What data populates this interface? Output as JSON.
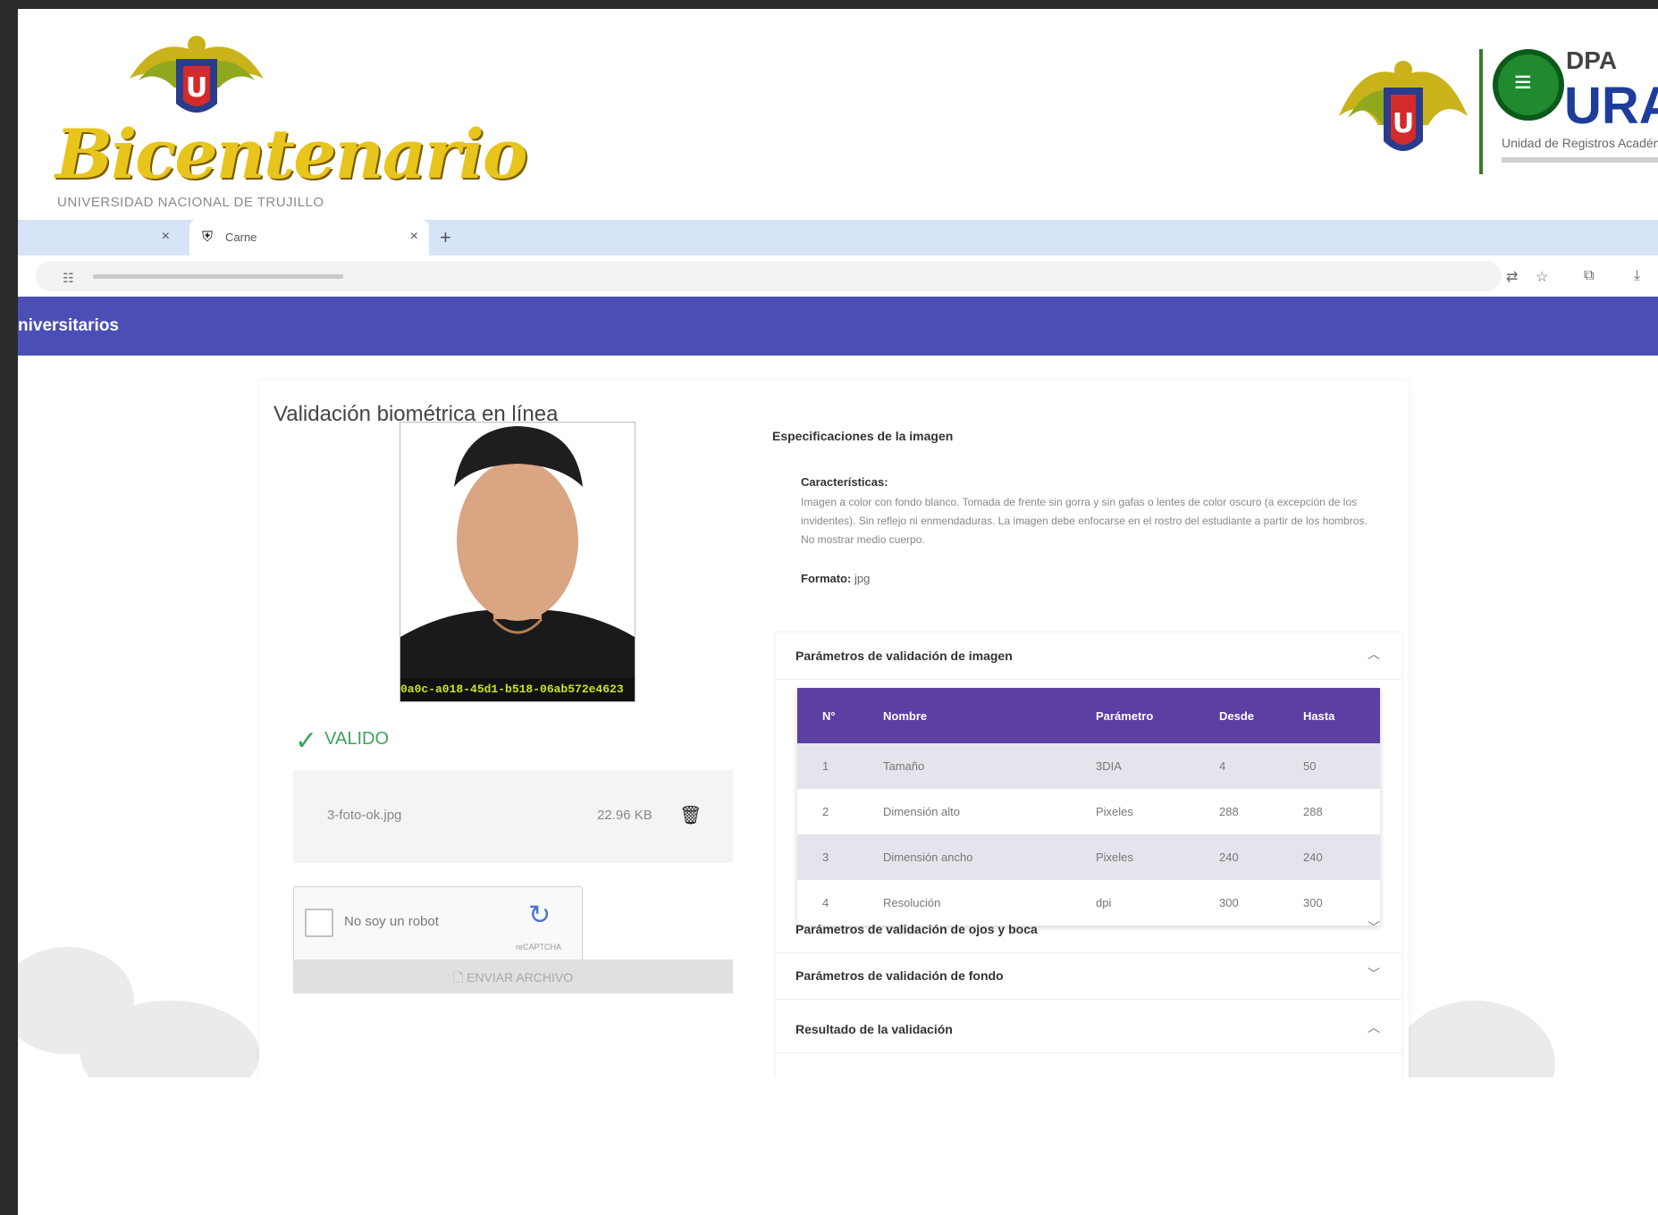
{
  "header": {
    "left_logo_text": "Bicentenario",
    "left_logo_subtitle": "UNIVERSIDAD NACIONAL DE TRUJILLO",
    "right_logo_dpa": "DPA",
    "right_logo_ura": "URA",
    "right_logo_subtitle": "Unidad de Registros Académicos"
  },
  "browser": {
    "tab_active_title": "Carne",
    "new_tab": "+",
    "close_glyph": "×"
  },
  "navbar": {
    "title": "niversitarios"
  },
  "card": {
    "title": "Validación biométrica en línea",
    "photo_id": "0a0c-a018-45d1-b518-06ab572e4623",
    "status": "VALIDO",
    "file_name": "3-foto-ok.jpg",
    "file_size": "22.96 KB",
    "captcha_label": "No soy un robot",
    "captcha_brand": "reCAPTCHA",
    "send_label": "ENVIAR ARCHIVO"
  },
  "specs": {
    "title": "Especificaciones de la imagen",
    "characteristics_label": "Características:",
    "characteristics_text": "Imagen a color con fondo blanco. Tomada de frente sin gorra y sin gafas o lentes de color oscuro (a excepción de los invidentes). Sin reflejo ni enmendaduras. La imagen debe enfocarse en el rostro del estudiante a partir de los hombros. No mostrar medio cuerpo.",
    "format_label": "Formato:",
    "format_value": "jpg"
  },
  "accordions": [
    {
      "title": "Parámetros de validación de imagen",
      "expanded": true
    },
    {
      "title": "Parámetros de validación de ojos y boca",
      "expanded": false
    },
    {
      "title": "Parámetros de validación de fondo",
      "expanded": false
    },
    {
      "title": "Resultado de la validación",
      "expanded": true
    }
  ],
  "table": {
    "headers": [
      "N°",
      "Nombre",
      "Parámetro",
      "Desde",
      "Hasta"
    ],
    "rows": [
      [
        "1",
        "Tamaño",
        "3DIA",
        "4",
        "50"
      ],
      [
        "2",
        "Dimensión alto",
        "Pixeles",
        "288",
        "288"
      ],
      [
        "3",
        "Dimensión ancho",
        "Pixeles",
        "240",
        "240"
      ],
      [
        "4",
        "Resolución",
        "dpi",
        "300",
        "300"
      ]
    ]
  },
  "colors": {
    "navbar": "#4b4fb5",
    "table_header": "#5b3fa3",
    "valid": "#3ea45a",
    "tabstrip": "#d7e4f7"
  }
}
